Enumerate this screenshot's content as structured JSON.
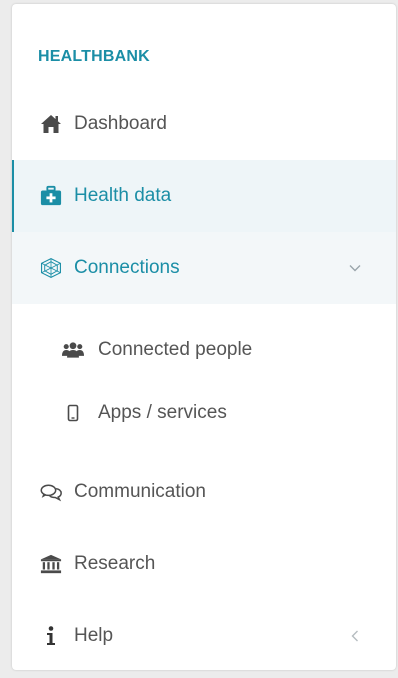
{
  "brand": "HEALTHBANK",
  "nav": {
    "dashboard": "Dashboard",
    "health_data": "Health data",
    "connections": "Connections",
    "connected_people": "Connected people",
    "apps_services": "Apps / services",
    "communication": "Communication",
    "research": "Research",
    "help": "Help"
  },
  "colors": {
    "accent": "#1b8ea6",
    "text": "#555555",
    "active_bg": "#eef5f8"
  },
  "icons": {
    "dashboard": "home-icon",
    "health_data": "medical-kit-icon",
    "connections": "network-icon",
    "connected_people": "users-icon",
    "apps_services": "mobile-icon",
    "communication": "chat-bubbles-icon",
    "research": "bank-icon",
    "help": "info-icon",
    "connections_toggle": "chevron-down-icon",
    "collapse": "chevron-left-icon"
  }
}
